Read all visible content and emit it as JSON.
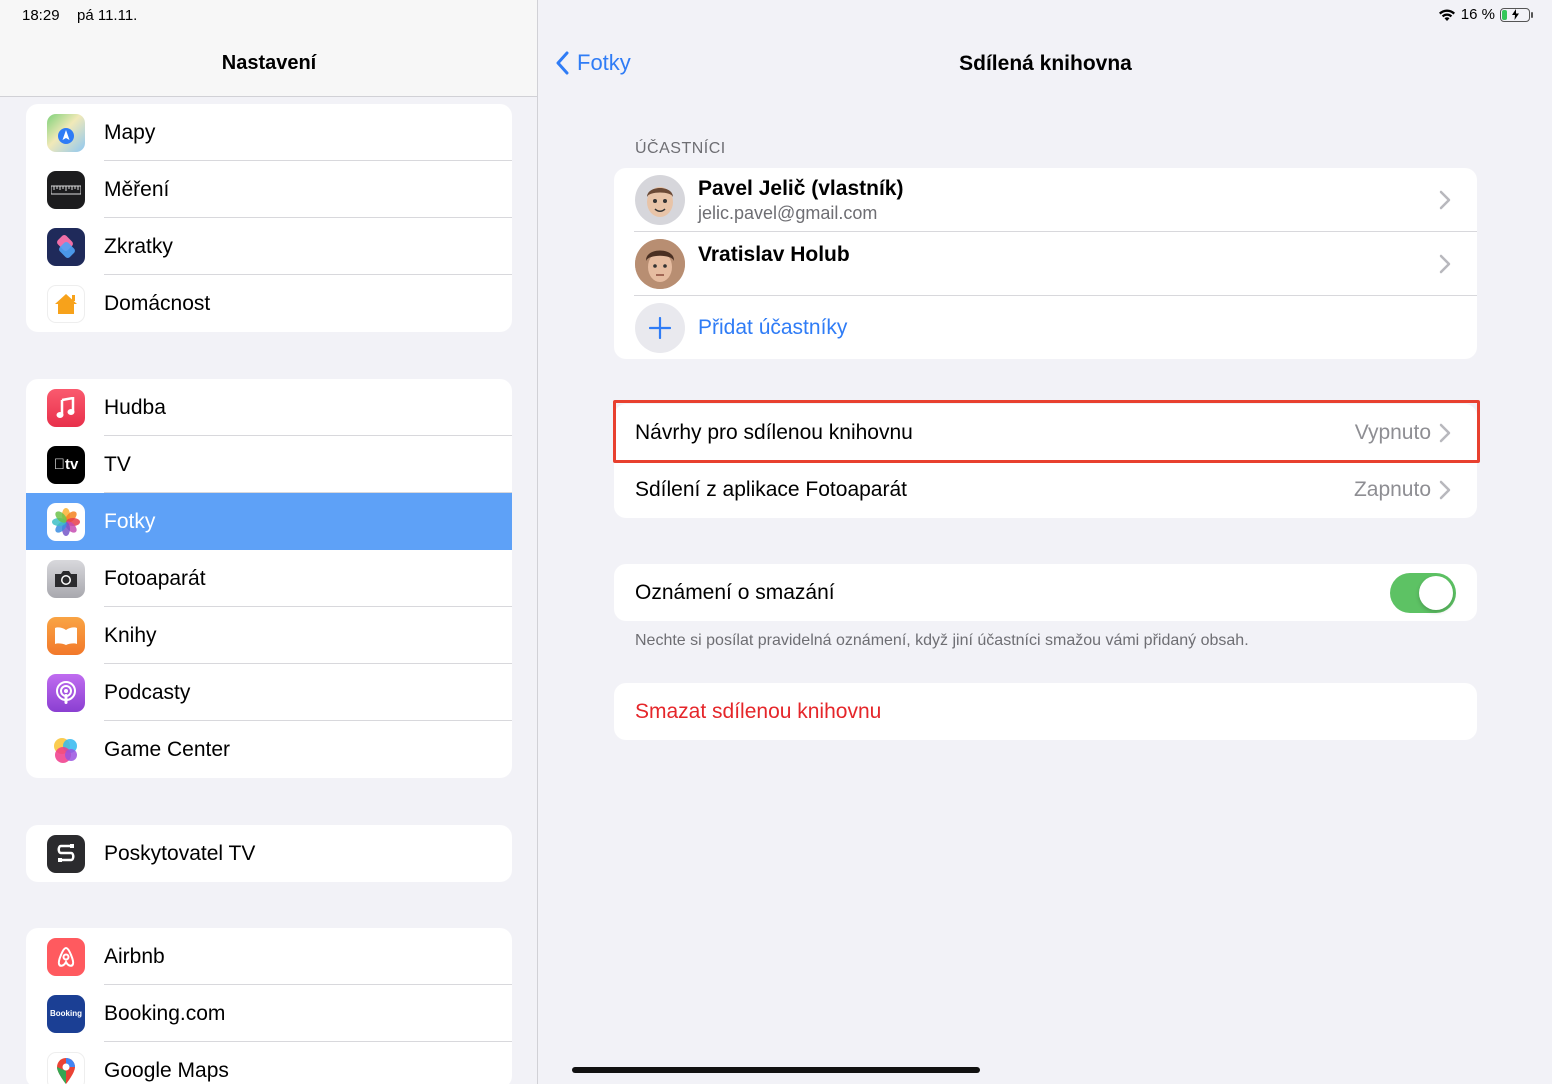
{
  "status_bar": {
    "time": "18:29",
    "date": "pá 11.11.",
    "battery": "16 %"
  },
  "sidebar": {
    "title": "Nastavení",
    "groups": [
      {
        "items": [
          {
            "label": "Mapy",
            "icon": "maps-icon"
          },
          {
            "label": "Měření",
            "icon": "measure-icon"
          },
          {
            "label": "Zkratky",
            "icon": "shortcuts-icon"
          },
          {
            "label": "Domácnost",
            "icon": "home-icon"
          }
        ]
      },
      {
        "items": [
          {
            "label": "Hudba",
            "icon": "music-icon"
          },
          {
            "label": "TV",
            "icon": "tv-icon"
          },
          {
            "label": "Fotky",
            "icon": "photos-icon",
            "selected": true
          },
          {
            "label": "Fotoaparát",
            "icon": "camera-icon"
          },
          {
            "label": "Knihy",
            "icon": "books-icon"
          },
          {
            "label": "Podcasty",
            "icon": "podcasts-icon"
          },
          {
            "label": "Game Center",
            "icon": "game-center-icon"
          }
        ]
      },
      {
        "items": [
          {
            "label": "Poskytovatel TV",
            "icon": "tv-provider-icon"
          }
        ]
      },
      {
        "items": [
          {
            "label": "Airbnb",
            "icon": "airbnb-icon"
          },
          {
            "label": "Booking.com",
            "icon": "booking-icon",
            "icon_text": "Booking"
          },
          {
            "label": "Google Maps",
            "icon": "google-maps-icon"
          }
        ]
      }
    ]
  },
  "detail": {
    "back_label": "Fotky",
    "title": "Sdílená knihovna",
    "participants_header": "ÚČASTNÍCI",
    "participants": [
      {
        "name": "Pavel Jelič (vlastník)",
        "email": "jelic.pavel@gmail.com"
      },
      {
        "name": "Vratislav Holub",
        "email": ""
      }
    ],
    "add_participants": "Přidat účastníky",
    "settings": [
      {
        "label": "Návrhy pro sdílenou knihovnu",
        "value": "Vypnuto"
      },
      {
        "label": "Sdílení z aplikace Fotoaparát",
        "value": "Zapnuto"
      }
    ],
    "deletion_notice": {
      "label": "Oznámení o smazání",
      "enabled": true,
      "footnote": "Nechte si posílat pravidelná oznámení, když jiní účastníci smažou vámi přidaný obsah."
    },
    "delete_library": "Smazat sdílenou knihovnu"
  },
  "colors": {
    "accent": "#2f7cf6",
    "selected_row": "#5ea1f7",
    "toggle_on": "#5dc264",
    "destructive": "#e5262a",
    "highlight": "#e8402f"
  }
}
